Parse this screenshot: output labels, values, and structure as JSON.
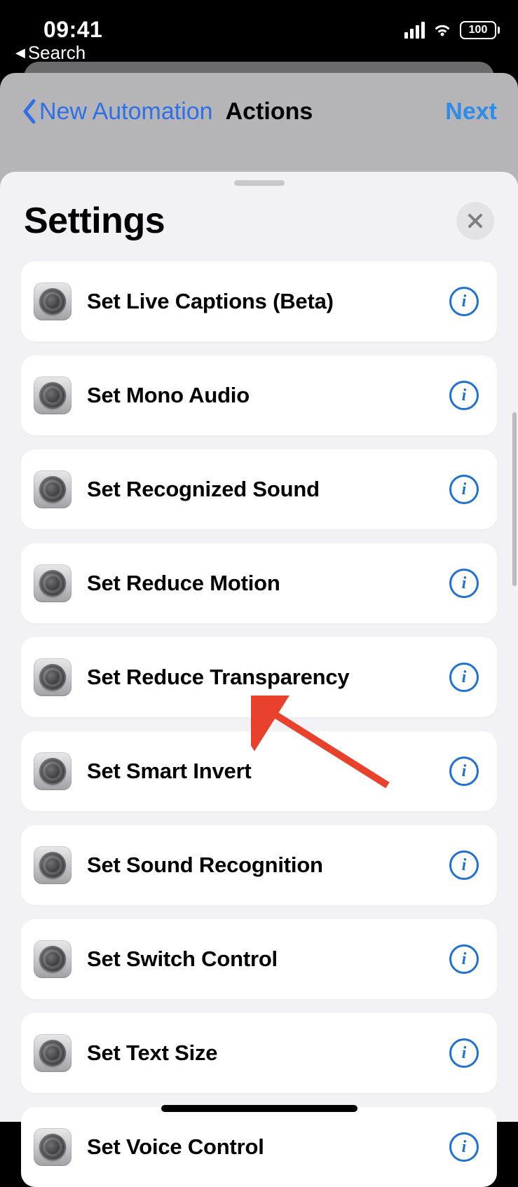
{
  "status": {
    "time": "09:41",
    "back_label": "Search",
    "battery": "100"
  },
  "nav": {
    "back_label": "New Automation",
    "title": "Actions",
    "next_label": "Next"
  },
  "sheet": {
    "title": "Settings"
  },
  "actions": [
    {
      "label": "Set Live Captions (Beta)"
    },
    {
      "label": "Set Mono Audio"
    },
    {
      "label": "Set Recognized Sound"
    },
    {
      "label": "Set Reduce Motion"
    },
    {
      "label": "Set Reduce Transparency"
    },
    {
      "label": "Set Smart Invert"
    },
    {
      "label": "Set Sound Recognition"
    },
    {
      "label": "Set Switch Control"
    },
    {
      "label": "Set Text Size"
    },
    {
      "label": "Set Voice Control"
    }
  ]
}
